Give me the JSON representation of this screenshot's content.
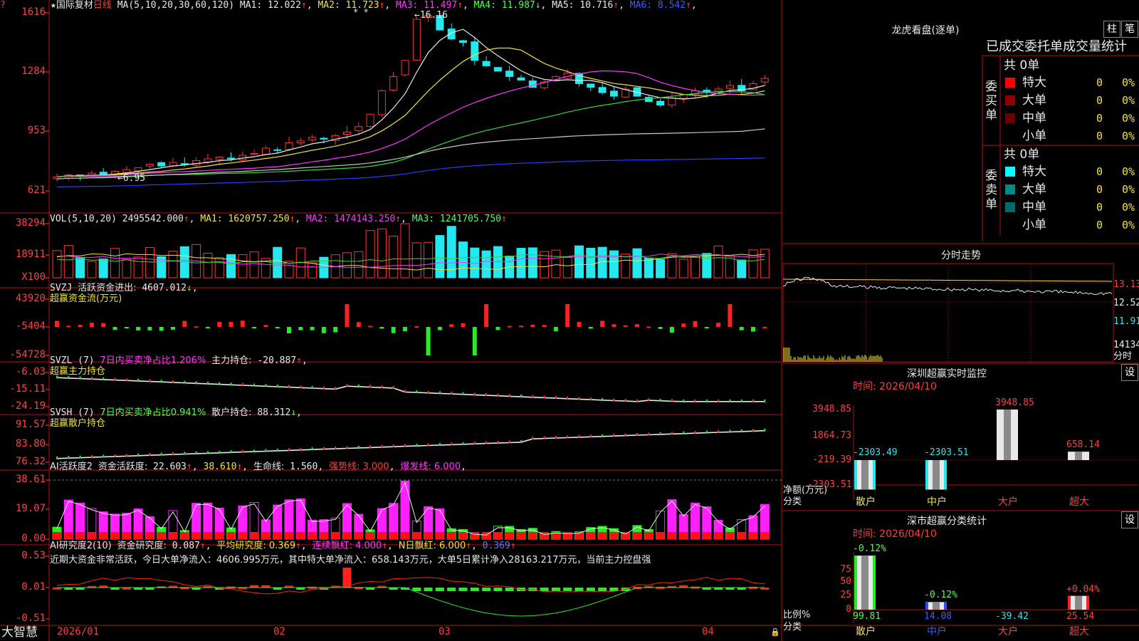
{
  "app_name": "大智慧",
  "stock": {
    "name": "国际复材",
    "period": "日线"
  },
  "ma_header": {
    "label": "MA(5,10,20,30,60,120)",
    "items": [
      {
        "name": "MA1",
        "value": "12.022",
        "dir": "↑",
        "color": "#e8e8e8"
      },
      {
        "name": "MA2",
        "value": "11.723",
        "dir": "↑",
        "color": "#f2e33a"
      },
      {
        "name": "MA3",
        "value": "11.497",
        "dir": "↑",
        "color": "#ff35ff"
      },
      {
        "name": "MA4",
        "value": "11.987",
        "dir": "↓",
        "color": "#4dff4d"
      },
      {
        "name": "MA5",
        "value": "10.716",
        "dir": "↑",
        "color": "#e8e8e8"
      },
      {
        "name": "MA6",
        "value": "8.542",
        "dir": "↑",
        "color": "#3a5cff"
      }
    ],
    "high_label": "16.16",
    "low_label": "6.95",
    "stars": "* *"
  },
  "price_axis": [
    "1616",
    "1284",
    "953",
    "621"
  ],
  "vol_header": {
    "label": "VOL(5,10,20)",
    "value": "2495542.000",
    "ma1": "1620757.250",
    "ma2": "1474143.250",
    "ma3": "1241705.750"
  },
  "vol_axis": [
    "38294",
    "18911",
    "X100"
  ],
  "svzj": {
    "label": "SVZJ",
    "text": "活跃资金进出:",
    "value": "4607.012",
    "dir": "↓",
    "sub": "超赢资金流(万元)",
    "axis": [
      "43920",
      "-5404",
      "-54728"
    ]
  },
  "svzl": {
    "label": "SVZL (7)",
    "ratio": "7日内买卖净占比1.206%",
    "text": "主力持仓:",
    "value": "-20.887",
    "dir": "↑",
    "sub": "超赢主力持仓",
    "axis": [
      "-6.03",
      "-15.11",
      "-24.19"
    ]
  },
  "svsh": {
    "label": "SVSH (7)",
    "ratio": "7日内买卖净占比0.941%",
    "text": "散户持仓:",
    "value": "88.312",
    "dir": "↓",
    "sub": "超赢散户持仓",
    "axis": [
      "91.57",
      "83.80",
      "76.32"
    ]
  },
  "ai_active": {
    "label": "AI活跃度2",
    "text": "资金活跃度:",
    "v1": "22.603",
    "v2": "38.610",
    "life_label": "生命线:",
    "life": "1.560",
    "strong": "强势线: 3.000",
    "burst": "爆发线: 6.000",
    "axis": [
      "38.61",
      "19.07",
      "0.00"
    ]
  },
  "ai_research": {
    "label": "AI研究度2(10)",
    "text": "资金研究度:",
    "v1": "0.087",
    "avg": "平均研究度: 0.369",
    "lian": "连续飘红: 4.000",
    "nred": "N日飘红: 6.000",
    "last": "0.369",
    "axis": [
      "0.53",
      "0.01",
      "-0.51"
    ],
    "comment": "近期大资金非常活跃，今日大单净流入：4606.995万元，其中特大单净流入：658.143万元，大单5日累计净入28163.217万元，当前主力控盘强"
  },
  "x_labels": [
    "2026/01",
    "02",
    "03",
    "04"
  ],
  "lhb": {
    "title": "龙虎看盘(逐单)",
    "btn1": "柱",
    "btn2": "笔",
    "subtitle": "已成交委托单成交量统计",
    "buy_label": "委买单",
    "sell_label": "委卖单",
    "buy_total": "共 0单",
    "sell_total": "共 0单",
    "rows": [
      {
        "name": "特大",
        "val": "0",
        "pct": "0%"
      },
      {
        "name": "大单",
        "val": "0",
        "pct": "0%"
      },
      {
        "name": "中单",
        "val": "0",
        "pct": "0%"
      },
      {
        "name": "小单",
        "val": "0",
        "pct": "0%"
      }
    ],
    "buy_colors": [
      "#ff0000",
      "#8b0000",
      "#6b0000",
      "#000000"
    ],
    "sell_colors": [
      "#00ffff",
      "#008b8b",
      "#006b6b",
      "#000000"
    ]
  },
  "fenshi": {
    "title": "分时走势",
    "axis": [
      "13.13",
      "12.52",
      "11.91"
    ],
    "vol": "14134",
    "unit": "分时"
  },
  "sz_monitor": {
    "title": "深圳超赢实时监控",
    "btn": "设",
    "date": "时间: 2026/04/10",
    "axis": [
      "3948.85",
      "1864.73",
      "-219.39",
      "-2303.51"
    ],
    "ylabel": "净额(万元)",
    "xlabel": "分类",
    "cats": [
      "散户",
      "中户",
      "大户",
      "超大"
    ],
    "values": [
      -2303.49,
      -2303.51,
      3948.85,
      658.14
    ],
    "labels": [
      "-2303.49",
      "-2303.51",
      "3948.85",
      "658.14"
    ]
  },
  "sz_class": {
    "title": "深市超赢分类统计",
    "btn": "设",
    "date": "时间: 2026/04/10",
    "axis": [
      "75",
      "50",
      "25",
      "0"
    ],
    "ylabel": "比例%",
    "xlabel": "分类",
    "cats": [
      "散户",
      "中户",
      "大户",
      "超大"
    ],
    "values": [
      99.81,
      14.08,
      -39.42,
      25.54
    ],
    "tops": [
      "-0.12%",
      "-0.12%",
      "",
      "+0.04%"
    ],
    "bottoms": [
      "99.81",
      "14.08",
      "-39.42",
      "25.54"
    ]
  }
}
